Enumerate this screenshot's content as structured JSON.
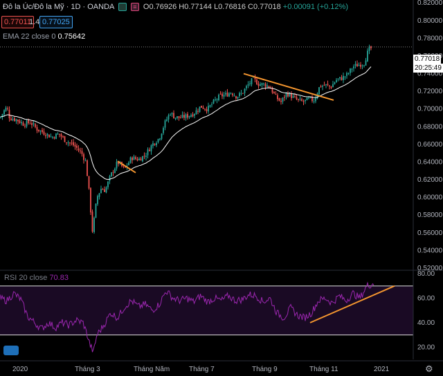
{
  "header": {
    "title": "Đô la Úc/Đô la Mỹ · 1D · OANDA",
    "open": "O0.76926",
    "high": "H0.77144",
    "low": "L0.76816",
    "close": "C0.77018",
    "change": "+0.00091 (+0.12%)"
  },
  "quote": {
    "bid": "0.77011",
    "spread": "1.4",
    "ask": "0.77025"
  },
  "ema_label": {
    "name": "EMA 22 close 0",
    "value": "0.75642"
  },
  "rsi_label": {
    "name": "RSI 20 close",
    "value": "70.83"
  },
  "price_tag": "0.77018",
  "time_tag": "20:25:49",
  "colors": {
    "up": "#26a69a",
    "down": "#ef5350",
    "ema": "#ffffff",
    "trend": "#f5962f",
    "rsi": "#9c27b0",
    "rsi_band": "#1a0a24"
  },
  "icons": {
    "logo": "tradingview-logo-icon",
    "settings": "gear-icon"
  },
  "chart_data": {
    "type": "candlestick",
    "symbol": "Đô la Úc/Đô la Mỹ",
    "timeframe": "1D",
    "ylim": [
      0.52,
      0.8233
    ],
    "yticks": [
      "0.82000",
      "0.80000",
      "0.78000",
      "0.76000",
      "0.74000",
      "0.72000",
      "0.70000",
      "0.68000",
      "0.66000",
      "0.64000",
      "0.62000",
      "0.60000",
      "0.58000",
      "0.56000",
      "0.54000",
      "0.52000"
    ],
    "xticks": [
      "2020",
      "Tháng 3",
      "Tháng Năm",
      "Tháng 7",
      "Tháng 9",
      "Tháng 11",
      "2021"
    ],
    "price_anchors": [
      [
        0,
        0.69
      ],
      [
        6,
        0.698
      ],
      [
        10,
        0.702
      ],
      [
        14,
        0.69
      ],
      [
        24,
        0.688
      ],
      [
        34,
        0.683
      ],
      [
        44,
        0.685
      ],
      [
        54,
        0.677
      ],
      [
        64,
        0.673
      ],
      [
        75,
        0.668
      ],
      [
        85,
        0.672
      ],
      [
        95,
        0.664
      ],
      [
        105,
        0.66
      ],
      [
        112,
        0.655
      ],
      [
        118,
        0.65
      ],
      [
        124,
        0.64
      ],
      [
        128,
        0.612
      ],
      [
        131,
        0.585
      ],
      [
        133,
        0.56
      ],
      [
        136,
        0.575
      ],
      [
        140,
        0.6
      ],
      [
        146,
        0.61
      ],
      [
        152,
        0.608
      ],
      [
        160,
        0.625
      ],
      [
        170,
        0.64
      ],
      [
        180,
        0.632
      ],
      [
        190,
        0.645
      ],
      [
        200,
        0.643
      ],
      [
        210,
        0.648
      ],
      [
        220,
        0.66
      ],
      [
        230,
        0.667
      ],
      [
        238,
        0.684
      ],
      [
        246,
        0.696
      ],
      [
        252,
        0.691
      ],
      [
        260,
        0.69
      ],
      [
        270,
        0.692
      ],
      [
        280,
        0.695
      ],
      [
        290,
        0.703
      ],
      [
        300,
        0.7
      ],
      [
        310,
        0.709
      ],
      [
        318,
        0.715
      ],
      [
        326,
        0.716
      ],
      [
        334,
        0.719
      ],
      [
        342,
        0.714
      ],
      [
        350,
        0.718
      ],
      [
        358,
        0.727
      ],
      [
        366,
        0.734
      ],
      [
        374,
        0.728
      ],
      [
        382,
        0.728
      ],
      [
        390,
        0.725
      ],
      [
        398,
        0.714
      ],
      [
        406,
        0.708
      ],
      [
        414,
        0.718
      ],
      [
        422,
        0.714
      ],
      [
        430,
        0.71
      ],
      [
        438,
        0.708
      ],
      [
        446,
        0.711
      ],
      [
        454,
        0.71
      ],
      [
        462,
        0.726
      ],
      [
        470,
        0.727
      ],
      [
        478,
        0.725
      ],
      [
        486,
        0.733
      ],
      [
        494,
        0.735
      ],
      [
        502,
        0.739
      ],
      [
        510,
        0.748
      ],
      [
        518,
        0.75
      ],
      [
        526,
        0.752
      ],
      [
        532,
        0.766
      ],
      [
        538,
        0.77
      ]
    ],
    "rsi": {
      "ylim": [
        10,
        80
      ],
      "yticks": [
        "80.00",
        "60.00",
        "40.00",
        "20.00"
      ],
      "bands": [
        70,
        30
      ],
      "anchors": [
        [
          0,
          60
        ],
        [
          10,
          58
        ],
        [
          20,
          64
        ],
        [
          30,
          59
        ],
        [
          40,
          45
        ],
        [
          50,
          40
        ],
        [
          60,
          35
        ],
        [
          70,
          40
        ],
        [
          80,
          36
        ],
        [
          90,
          40
        ],
        [
          100,
          38
        ],
        [
          110,
          42
        ],
        [
          120,
          40
        ],
        [
          126,
          30
        ],
        [
          130,
          22
        ],
        [
          135,
          16
        ],
        [
          140,
          30
        ],
        [
          150,
          38
        ],
        [
          160,
          48
        ],
        [
          170,
          44
        ],
        [
          180,
          53
        ],
        [
          190,
          58
        ],
        [
          200,
          53
        ],
        [
          210,
          55
        ],
        [
          220,
          50
        ],
        [
          230,
          55
        ],
        [
          240,
          66
        ],
        [
          250,
          60
        ],
        [
          260,
          58
        ],
        [
          270,
          60
        ],
        [
          280,
          57
        ],
        [
          290,
          62
        ],
        [
          300,
          57
        ],
        [
          310,
          60
        ],
        [
          320,
          58
        ],
        [
          330,
          62
        ],
        [
          340,
          58
        ],
        [
          350,
          59
        ],
        [
          360,
          63
        ],
        [
          370,
          62
        ],
        [
          380,
          57
        ],
        [
          390,
          60
        ],
        [
          400,
          48
        ],
        [
          410,
          44
        ],
        [
          420,
          52
        ],
        [
          430,
          46
        ],
        [
          440,
          44
        ],
        [
          450,
          48
        ],
        [
          460,
          58
        ],
        [
          470,
          60
        ],
        [
          480,
          56
        ],
        [
          490,
          62
        ],
        [
          500,
          58
        ],
        [
          510,
          64
        ],
        [
          520,
          60
        ],
        [
          530,
          70
        ],
        [
          540,
          72
        ]
      ]
    },
    "trendlines": [
      {
        "pane": "price",
        "from": [
          170,
          0.641
        ],
        "to": [
          196,
          0.628
        ]
      },
      {
        "pane": "price",
        "from": [
          352,
          0.74
        ],
        "to": [
          482,
          0.71
        ]
      },
      {
        "pane": "rsi",
        "from": [
          448,
          40
        ],
        "to": [
          570,
          70
        ]
      }
    ]
  }
}
